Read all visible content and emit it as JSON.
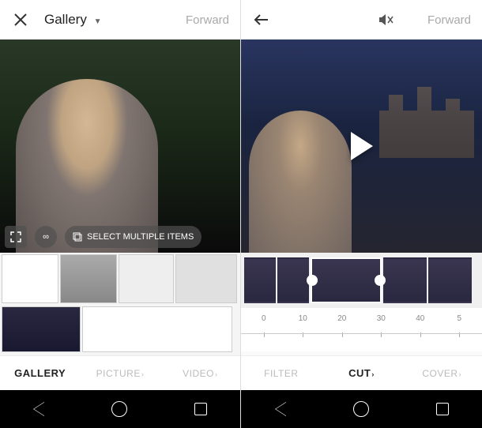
{
  "left_panel": {
    "close_action": "close",
    "title": "Gallery",
    "forward_label": "Forward",
    "overlay": {
      "expand_icon": "expand",
      "infinity_icon": "infinity",
      "multi_select_label": "SELECT MULTIPLE ITEMS"
    },
    "tabs": {
      "gallery": "GALLERY",
      "picture": "PICTURE",
      "video": "VIDEO"
    }
  },
  "right_panel": {
    "back_action": "back",
    "mute_state": "muted",
    "forward_label": "Forward",
    "tabs": {
      "filter": "FILTER",
      "cut": "CUT",
      "cover": "COVER"
    },
    "ruler_ticks": [
      "0",
      "10",
      "20",
      "30",
      "40",
      "5"
    ]
  }
}
